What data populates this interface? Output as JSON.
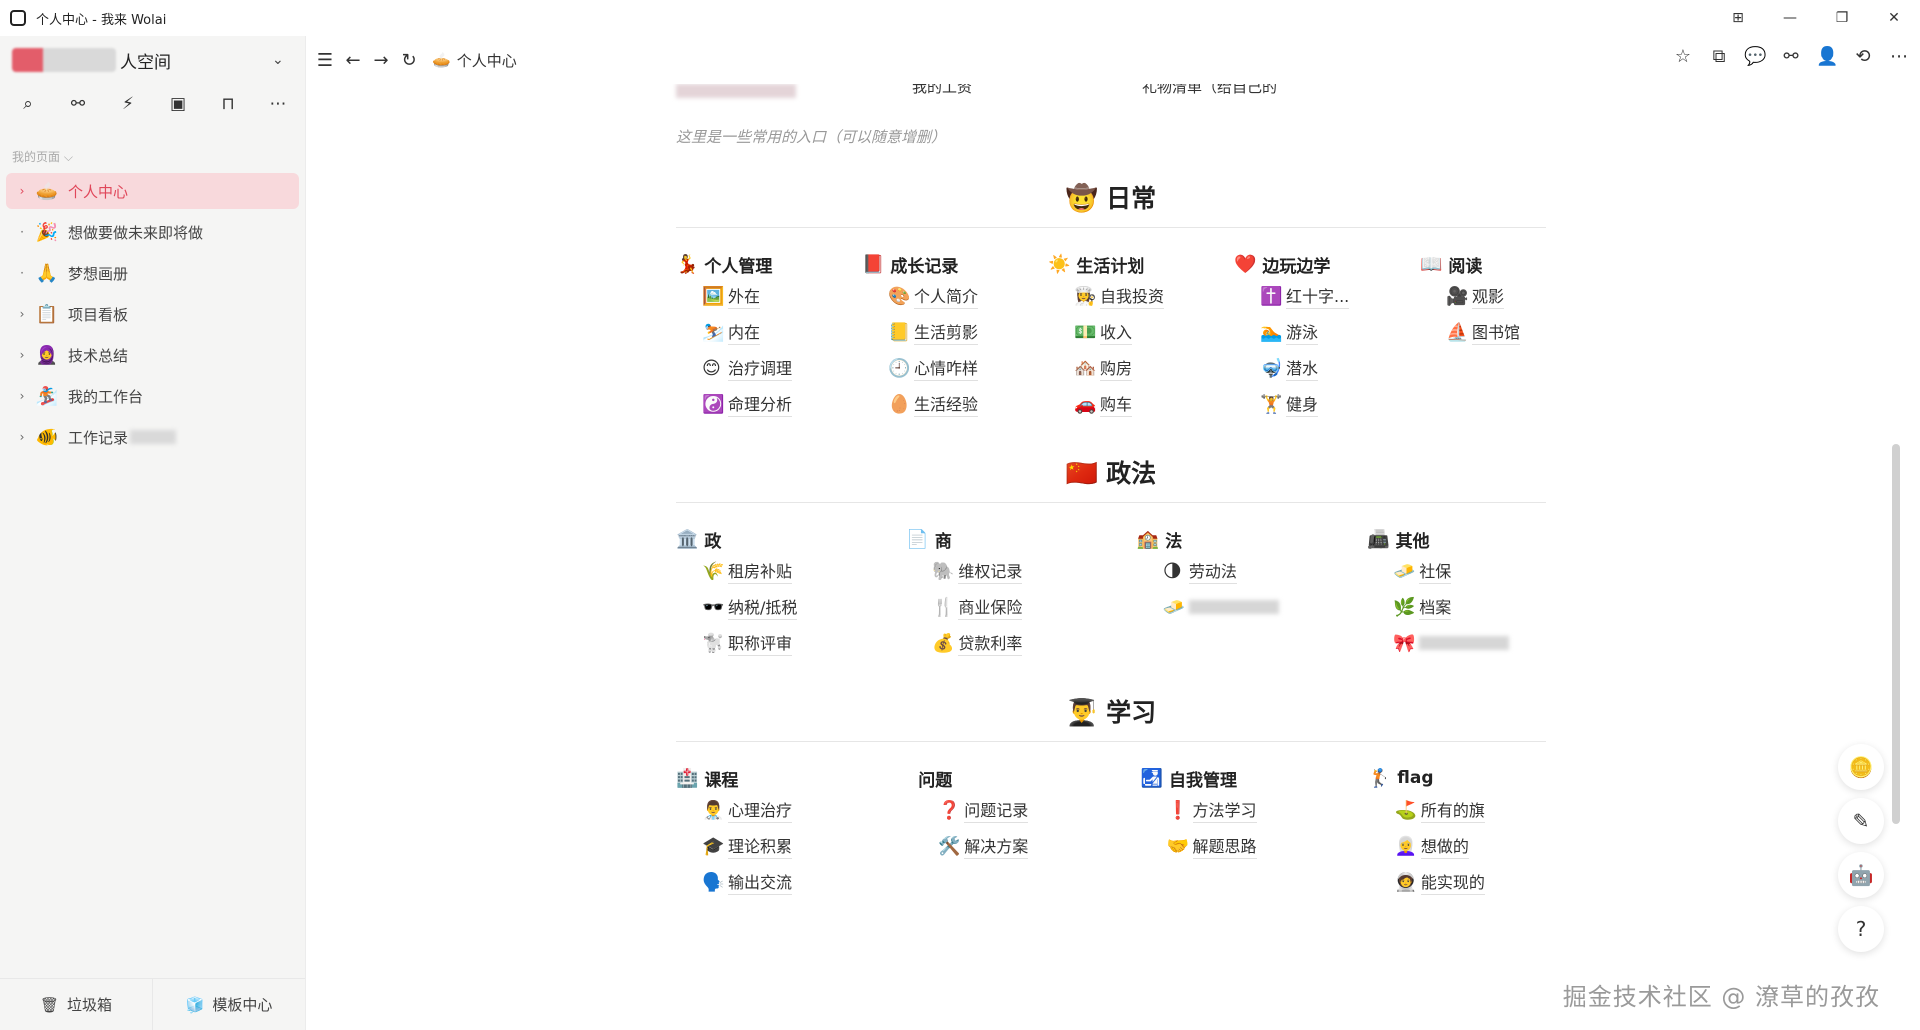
{
  "window": {
    "title": "个人中心 - 我来 Wolai",
    "controls": [
      "⊞",
      "—",
      "❐",
      "✕"
    ]
  },
  "sidebar": {
    "space_name": "人空间",
    "tool_icons": [
      "search-icon",
      "graph-icon",
      "lightning-icon",
      "layout-icon",
      "inbox-icon",
      "more-icon"
    ],
    "section_label": "我的页面 ⌵",
    "items": [
      {
        "label": "个人中心",
        "emoji": "🥧",
        "arrow": "›",
        "active": true
      },
      {
        "label": "想做要做未来即将做",
        "emoji": "🎉",
        "arrow": "·"
      },
      {
        "label": "梦想画册",
        "emoji": "🙏",
        "arrow": "·"
      },
      {
        "label": "项目看板",
        "emoji": "📋",
        "arrow": "›"
      },
      {
        "label": "技术总结",
        "emoji": "🧕",
        "arrow": "›"
      },
      {
        "label": "我的工作台",
        "emoji": "🏂",
        "arrow": "›"
      },
      {
        "label": "工作记录",
        "emoji": "🐠",
        "arrow": "›"
      }
    ],
    "bottom": {
      "trash": "垃圾箱",
      "templates": "模板中心"
    }
  },
  "topbar": {
    "breadcrumb": "个人中心",
    "breadcrumb_emoji": "🥧"
  },
  "content": {
    "top_partial": [
      "我的工资",
      "礼物清单（给自己的"
    ],
    "hint": "这里是一些常用的入口（可以随意增删）",
    "sections": [
      {
        "title": "日常",
        "emoji": "🤠",
        "columns": [
          {
            "title": "个人管理",
            "emoji": "💃",
            "links": [
              {
                "e": "🖼️",
                "t": "外在"
              },
              {
                "e": "⛷️",
                "t": "内在"
              },
              {
                "e": "😊",
                "t": "治疗调理"
              },
              {
                "e": "☯️",
                "t": "命理分析"
              }
            ]
          },
          {
            "title": "成长记录",
            "emoji": "📕",
            "links": [
              {
                "e": "🎨",
                "t": "个人简介"
              },
              {
                "e": "📒",
                "t": "生活剪影"
              },
              {
                "e": "🕘",
                "t": "心情咋样"
              },
              {
                "e": "🥚",
                "t": "生活经验"
              }
            ]
          },
          {
            "title": "生活计划",
            "emoji": "☀️",
            "links": [
              {
                "e": "👩‍🍳",
                "t": "自我投资"
              },
              {
                "e": "💵",
                "t": "收入"
              },
              {
                "e": "🏘️",
                "t": "购房"
              },
              {
                "e": "🚗",
                "t": "购车"
              }
            ]
          },
          {
            "title": "边玩边学",
            "emoji": "❤️",
            "links": [
              {
                "e": "✝️",
                "t": "红十字..."
              },
              {
                "e": "🏊",
                "t": "游泳"
              },
              {
                "e": "🤿",
                "t": "潜水"
              },
              {
                "e": "🏋️",
                "t": "健身"
              }
            ]
          },
          {
            "title": "阅读",
            "emoji": "📖",
            "links": [
              {
                "e": "🎥",
                "t": "观影"
              },
              {
                "e": "⛵",
                "t": "图书馆"
              }
            ]
          }
        ]
      },
      {
        "title": "政法",
        "emoji": "🇨🇳",
        "columns": [
          {
            "title": "政",
            "emoji": "🏛️",
            "links": [
              {
                "e": "🌾",
                "t": "租房补贴"
              },
              {
                "e": "🕶️",
                "t": "纳税/抵税"
              },
              {
                "e": "🐩",
                "t": "职称评审"
              }
            ]
          },
          {
            "title": "商",
            "emoji": "📄",
            "links": [
              {
                "e": "🐘",
                "t": "维权记录"
              },
              {
                "e": "🍴",
                "t": "商业保险"
              },
              {
                "e": "💰",
                "t": "贷款利率"
              }
            ]
          },
          {
            "title": "法",
            "emoji": "🏫",
            "links": [
              {
                "e": "🌗",
                "t": "劳动法"
              },
              {
                "e": "🧈",
                "t": ""
              }
            ]
          },
          {
            "title": "其他",
            "emoji": "📠",
            "links": [
              {
                "e": "🧈",
                "t": "社保"
              },
              {
                "e": "🌿",
                "t": "档案"
              },
              {
                "e": "🎀",
                "t": ""
              }
            ]
          }
        ]
      },
      {
        "title": "学习",
        "emoji": "👨‍🎓",
        "columns": [
          {
            "title": "课程",
            "emoji": "🏥",
            "links": [
              {
                "e": "👨‍⚕️",
                "t": "心理治疗"
              },
              {
                "e": "🎓",
                "t": "理论积累"
              },
              {
                "e": "🗣️",
                "t": "输出交流"
              }
            ]
          },
          {
            "title": "问题",
            "emoji": "",
            "links": [
              {
                "e": "❓",
                "t": "问题记录"
              },
              {
                "e": "🛠️",
                "t": "解决方案"
              }
            ]
          },
          {
            "title": "自我管理",
            "emoji": "🛃",
            "links": [
              {
                "e": "❗",
                "t": "方法学习"
              },
              {
                "e": "🤝",
                "t": "解题思路"
              }
            ]
          },
          {
            "title": "flag",
            "emoji": "🏌️",
            "links": [
              {
                "e": "⛳",
                "t": "所有的旗"
              },
              {
                "e": "👩‍🦳",
                "t": "想做的"
              },
              {
                "e": "🧑‍🚀",
                "t": "能实现的"
              }
            ]
          }
        ]
      }
    ]
  },
  "floating": [
    "coin-icon",
    "edit-icon",
    "ai-icon",
    "help-icon"
  ],
  "watermark": "掘金技术社区 @ 潦草的孜孜"
}
